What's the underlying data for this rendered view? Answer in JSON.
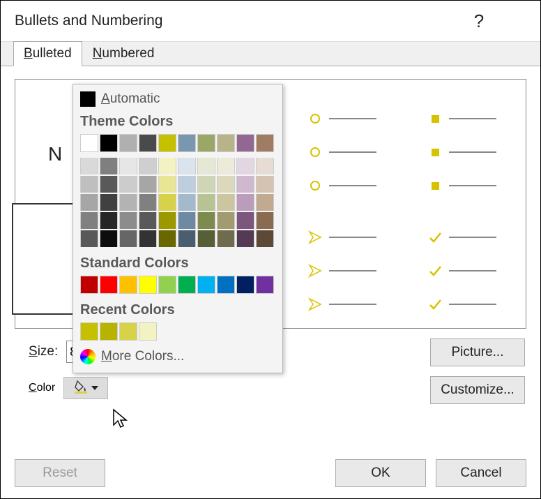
{
  "title": "Bullets and Numbering",
  "tabs": {
    "bulleted": "Bulleted",
    "numbered": "Numbered"
  },
  "preview": {
    "none_label": "N"
  },
  "size_label": "Size:",
  "size_value_fragment": "8",
  "color_label": "Color",
  "buttons": {
    "picture": "Picture...",
    "customize": "Customize...",
    "reset": "Reset",
    "ok": "OK",
    "cancel": "Cancel"
  },
  "picker": {
    "automatic": "Automatic",
    "theme_heading": "Theme Colors",
    "theme_row": [
      "#ffffff",
      "#000000",
      "#b0b0b0",
      "#4a4a4a",
      "#c5c100",
      "#7a97b0",
      "#9aa766",
      "#b8b389",
      "#926792",
      "#a07c63"
    ],
    "tints": [
      [
        "#d9d9d9",
        "#7f7f7f",
        "#e6e6e6",
        "#cfcfcf",
        "#f3f2c2",
        "#dbe3ec",
        "#e4e8d5",
        "#ecead9",
        "#e3d6e3",
        "#e6dcd3"
      ],
      [
        "#bfbfbf",
        "#595959",
        "#cccccc",
        "#a6a6a6",
        "#e8e694",
        "#bfcedc",
        "#cfd6b5",
        "#dcd8bd",
        "#cfb9cf",
        "#d4c3b2"
      ],
      [
        "#a6a6a6",
        "#404040",
        "#b3b3b3",
        "#808080",
        "#d6d24a",
        "#a3b9cc",
        "#b8c393",
        "#cbc6a0",
        "#bb9cbb",
        "#c2aa91"
      ],
      [
        "#808080",
        "#262626",
        "#8c8c8c",
        "#595959",
        "#9b9800",
        "#6e8aa3",
        "#7e8b4f",
        "#a29b6f",
        "#7d567d",
        "#8a6a51"
      ],
      [
        "#595959",
        "#0d0d0d",
        "#666666",
        "#333333",
        "#6a6700",
        "#4a5e70",
        "#565f36",
        "#706b4c",
        "#553a55",
        "#5e4837"
      ]
    ],
    "standard_heading": "Standard Colors",
    "standard": [
      "#c00000",
      "#ff0000",
      "#ffc000",
      "#ffff00",
      "#92d050",
      "#00b050",
      "#00b0f0",
      "#0070c0",
      "#002060",
      "#7030a0"
    ],
    "recent_heading": "Recent Colors",
    "recent": [
      "#c5c100",
      "#b8b300",
      "#d6d24a",
      "#f3f2c2"
    ],
    "more": "More Colors..."
  }
}
